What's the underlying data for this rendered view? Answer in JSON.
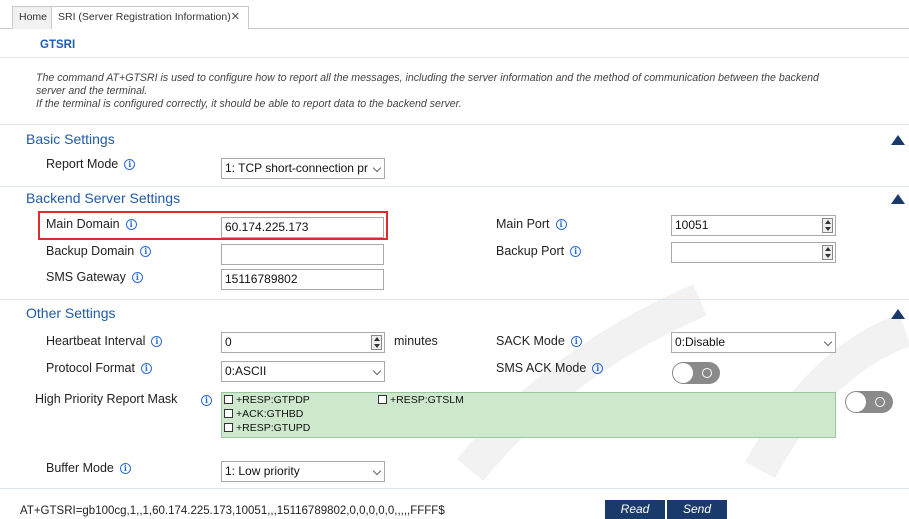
{
  "tabs": [
    {
      "label": "Home"
    },
    {
      "label": "SRI (Server Registration Information)"
    }
  ],
  "tab_close": "✕",
  "command_title": "GTSRI",
  "description": [
    "The command AT+GTSRI is used to configure how to report all the messages, including the server information and the method of communication between the backend",
    "server and the terminal.",
    "If the terminal is configured correctly, it should be able to report data to the backend server."
  ],
  "sections": {
    "basic": {
      "title": "Basic Settings",
      "report_mode_label": "Report Mode",
      "report_mode_value": "1: TCP short-connection pr"
    },
    "backend": {
      "title": "Backend Server Settings",
      "main_domain_label": "Main Domain",
      "main_domain_value": "60.174.225.173",
      "backup_domain_label": "Backup Domain",
      "backup_domain_value": "",
      "sms_gateway_label": "SMS Gateway",
      "sms_gateway_value": "15116789802",
      "main_port_label": "Main Port",
      "main_port_value": "10051",
      "backup_port_label": "Backup Port",
      "backup_port_value": ""
    },
    "other": {
      "title": "Other Settings",
      "heartbeat_label": "Heartbeat Interval",
      "heartbeat_value": "0",
      "heartbeat_unit": "minutes",
      "protocol_label": "Protocol Format",
      "protocol_value": "0:ASCII",
      "sack_mode_label": "SACK Mode",
      "sack_mode_value": "0:Disable",
      "sms_ack_label": "SMS ACK Mode",
      "sms_ack_on": false,
      "high_priority_label": "High Priority Report Mask",
      "high_priority_on": false,
      "mask_options": [
        {
          "label": "+RESP:GTPDP",
          "checked": false
        },
        {
          "label": "+RESP:GTSLM",
          "checked": false
        },
        {
          "label": "+ACK:GTHBD",
          "checked": false
        },
        {
          "label": "+RESP:GTUPD",
          "checked": false
        }
      ],
      "buffer_mode_label": "Buffer Mode",
      "buffer_mode_value": "1: Low priority"
    }
  },
  "at_command": "AT+GTSRI=gb100cg,1,,1,60.174.225.173,10051,,,15116789802,0,0,0,0,0,,,,,FFFF$",
  "buttons": {
    "read": "Read",
    "send": "Send"
  },
  "info_icon_glyph": "i",
  "colors": {
    "accent": "#1e5aa8",
    "button": "#1a3a6c",
    "highlight": "#e02b2b",
    "mask_bg": "#cde8cd"
  }
}
